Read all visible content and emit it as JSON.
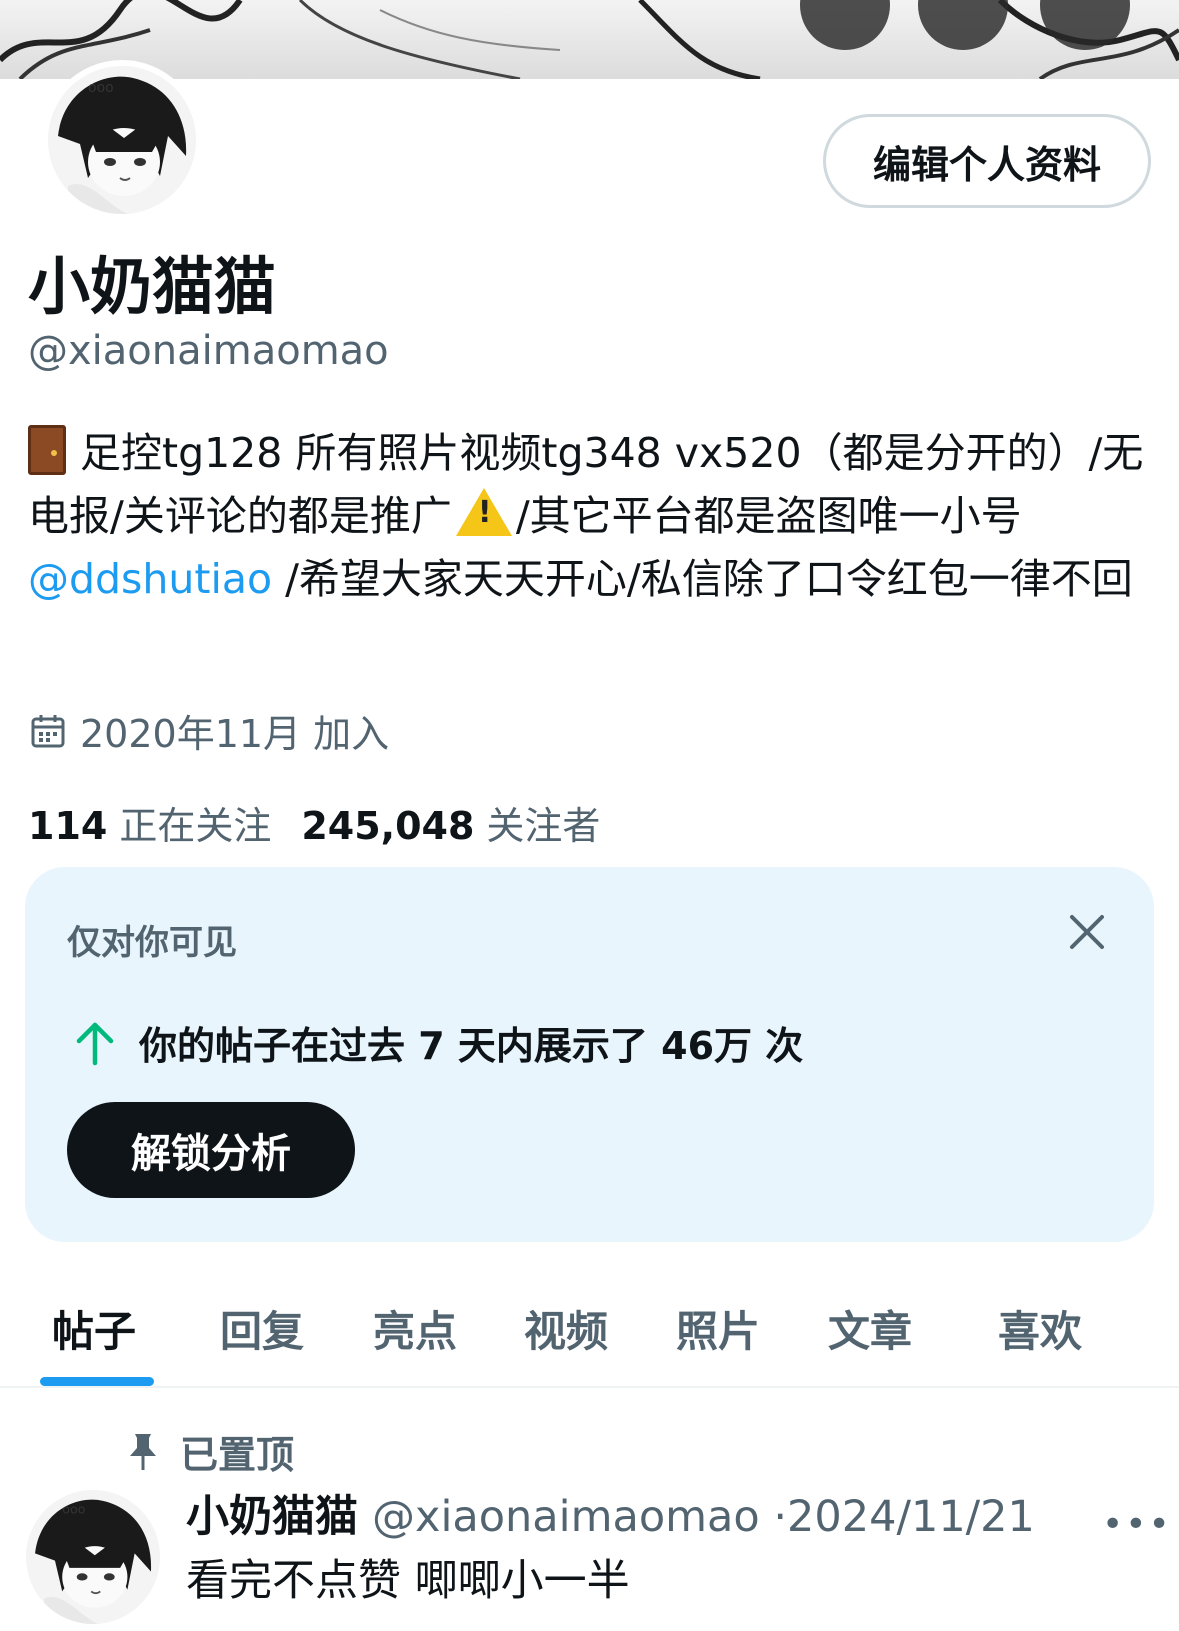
{
  "profile": {
    "edit_button": "编辑个人资料",
    "display_name": "小奶猫猫",
    "handle": "@xiaonaimaomao",
    "bio": {
      "part1": "足控tg128 所有照片视频tg348 vx520（都是分开的）/无电报/关评论的都是推广",
      "part2": "/其它平台都是盗图唯一小号",
      "mention": "@ddshutiao",
      "part3": " /希望大家天天开心/私信除了口令红包一律不回"
    },
    "joined": "2020年11月 加入",
    "following_count": "114",
    "following_label": "正在关注",
    "followers_count": "245,048",
    "followers_label": "关注者"
  },
  "insight_card": {
    "label": "仅对你可见",
    "stat": "你的帖子在过去 7 天内展示了 46万 次",
    "unlock_button": "解锁分析"
  },
  "tabs": [
    "帖子",
    "回复",
    "亮点",
    "视频",
    "照片",
    "文章",
    "喜欢"
  ],
  "active_tab": "帖子",
  "pinned_post": {
    "pinned_label": "已置顶",
    "author_name": "小奶猫猫",
    "author_handle": "@xiaonaimaomao",
    "separator": "·",
    "date": "2024/11/21",
    "more": "•••",
    "text": "看完不点赞 唧唧小一半"
  },
  "colors": {
    "accent": "#1d9bf0",
    "secondary_text": "#536471",
    "card_bg": "#e8f5fd",
    "growth": "#00ba7c"
  },
  "icons": [
    "calendar-icon",
    "close-icon",
    "arrow-up-icon",
    "pin-icon",
    "more-icon"
  ]
}
